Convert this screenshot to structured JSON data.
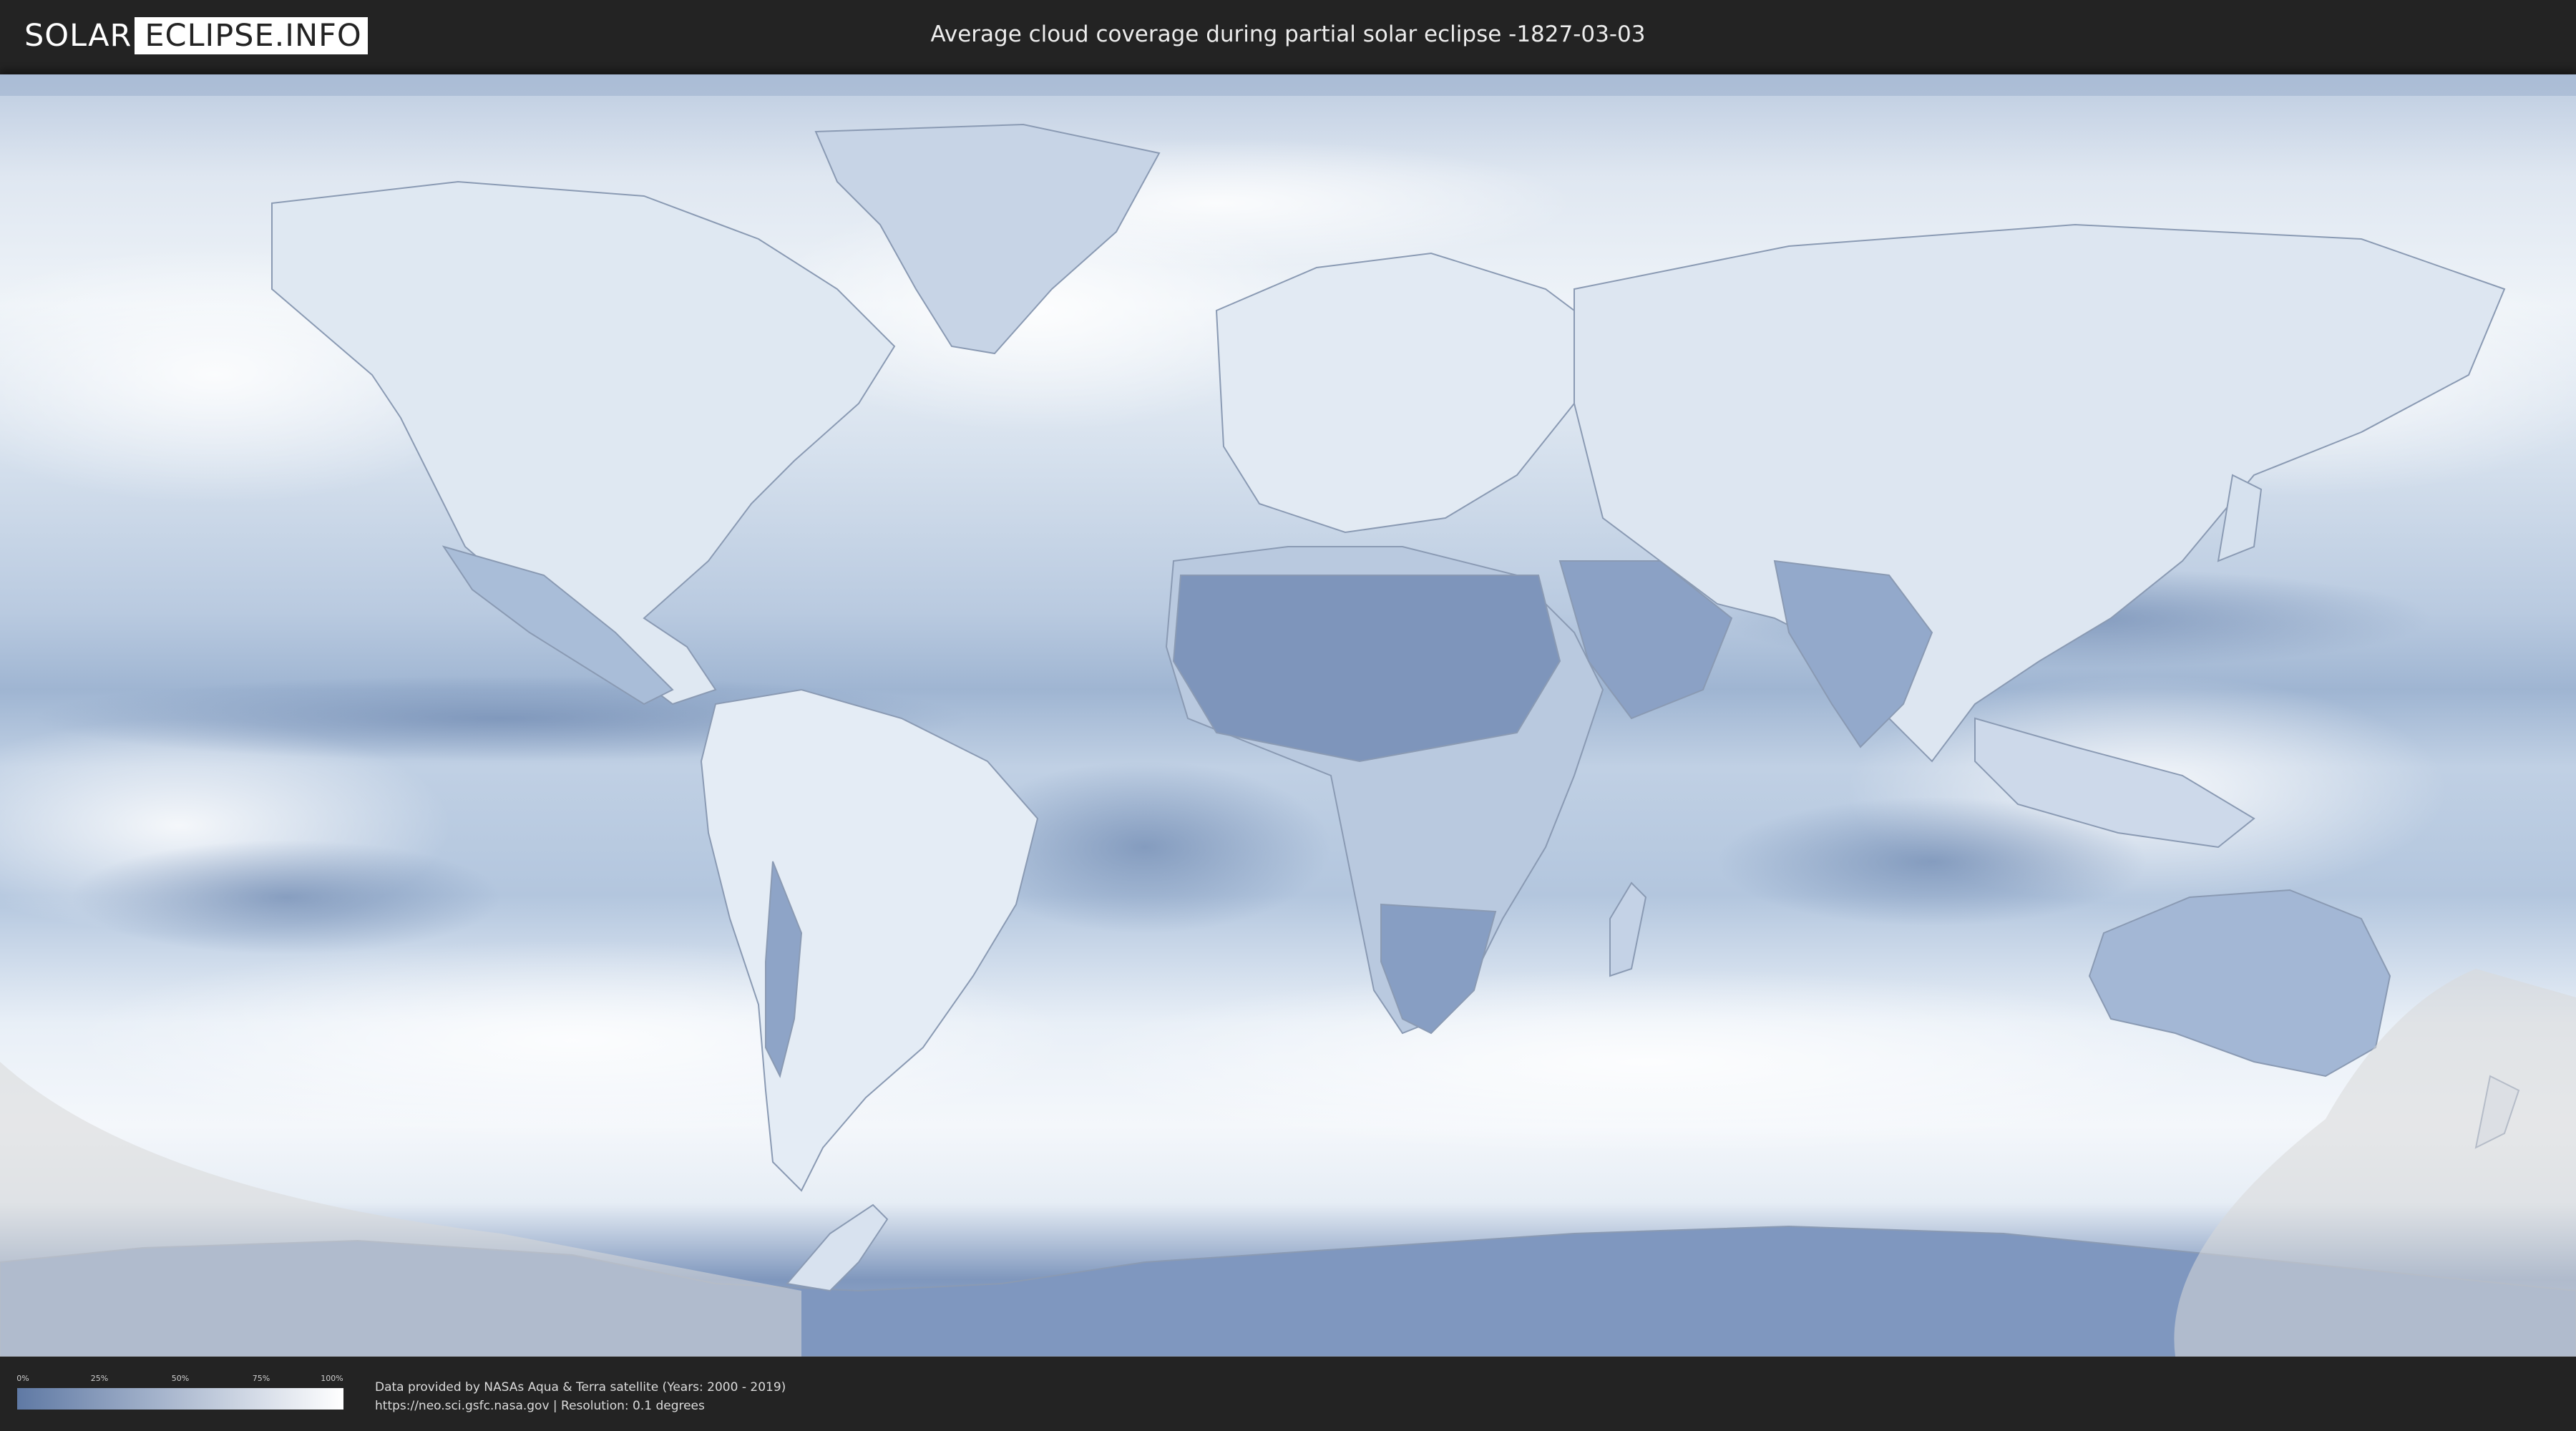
{
  "header": {
    "logo_left": "SOLAR",
    "logo_right": "ECLIPSE.INFO",
    "title": "Average cloud coverage during partial solar eclipse -1827-03-03"
  },
  "legend": {
    "ticks": [
      "0%",
      "25%",
      "50%",
      "75%",
      "100%"
    ],
    "colors": {
      "low": "#5f79a4",
      "high": "#ffffff"
    }
  },
  "attribution": {
    "line1": "Data provided by NASAs Aqua & Terra satellite (Years: 2000 - 2019)",
    "line2": "https://neo.sci.gsfc.nasa.gov | Resolution: 0.1 degrees"
  },
  "map": {
    "projection": "equirectangular",
    "colors": {
      "clear": "#6a84ad",
      "cloudy": "#f4f7fb",
      "eclipse_overlay": "#d9d9d9",
      "borders": "#8a9ab3"
    }
  }
}
